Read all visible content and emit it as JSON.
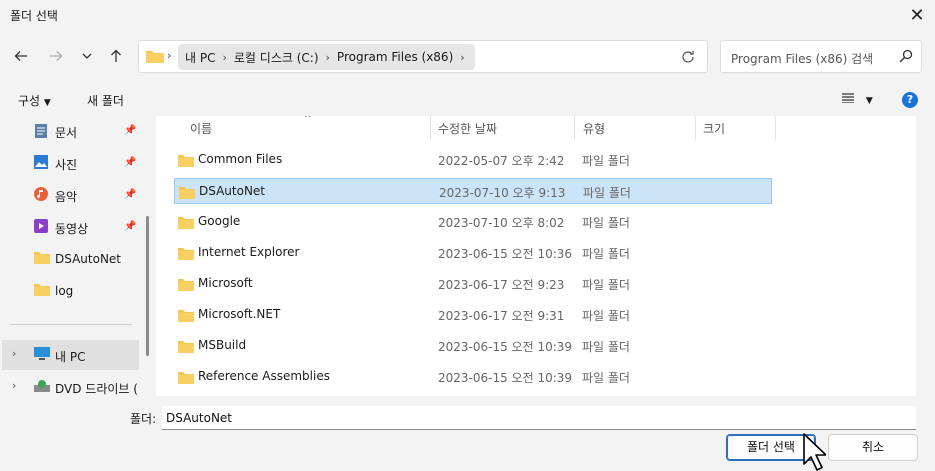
{
  "window": {
    "title": "폴더 선택",
    "close_icon": "close-icon"
  },
  "nav": {
    "back_icon": "arrow-left-icon",
    "forward_icon": "arrow-right-icon",
    "recent_icon": "chevron-down-icon",
    "up_icon": "arrow-up-icon",
    "breadcrumbs": [
      "내 PC",
      "로컬 디스크 (C:)",
      "Program Files (x86)"
    ],
    "refresh_icon": "refresh-icon"
  },
  "search": {
    "placeholder": "Program Files (x86) 검색"
  },
  "toolbar": {
    "organize_label": "구성",
    "new_folder_label": "새 폴더",
    "help": "?"
  },
  "sidebar": {
    "items": [
      {
        "label": "문서",
        "icon": "documents-icon",
        "pinned": true
      },
      {
        "label": "사진",
        "icon": "pictures-icon",
        "pinned": true
      },
      {
        "label": "음악",
        "icon": "music-icon",
        "pinned": true
      },
      {
        "label": "동영상",
        "icon": "videos-icon",
        "pinned": true
      },
      {
        "label": "DSAutoNet",
        "icon": "folder-icon",
        "pinned": false
      },
      {
        "label": "log",
        "icon": "folder-icon",
        "pinned": false
      }
    ],
    "tree": [
      {
        "label": "내 PC",
        "icon": "computer-icon"
      },
      {
        "label": "DVD 드라이브 (",
        "icon": "dvd-drive-icon"
      }
    ]
  },
  "list": {
    "columns": [
      "이름",
      "수정한 날짜",
      "유형",
      "크기"
    ],
    "rows": [
      {
        "name": "Common Files",
        "date": "2022-05-07 오후 2:42",
        "type": "파일 폴더"
      },
      {
        "name": "DSAutoNet",
        "date": "2023-07-10 오후 9:13",
        "type": "파일 폴더",
        "selected": true
      },
      {
        "name": "Google",
        "date": "2023-07-10 오후 8:02",
        "type": "파일 폴더"
      },
      {
        "name": "Internet Explorer",
        "date": "2023-06-15 오전 10:36",
        "type": "파일 폴더"
      },
      {
        "name": "Microsoft",
        "date": "2023-06-17 오전 9:23",
        "type": "파일 폴더"
      },
      {
        "name": "Microsoft.NET",
        "date": "2023-06-17 오전 9:31",
        "type": "파일 폴더"
      },
      {
        "name": "MSBuild",
        "date": "2023-06-15 오전 10:39",
        "type": "파일 폴더"
      },
      {
        "name": "Reference Assemblies",
        "date": "2023-06-15 오전 10:39",
        "type": "파일 폴더"
      }
    ]
  },
  "footer": {
    "folder_label": "폴더:",
    "folder_value": "DSAutoNet",
    "select_label": "폴더 선택",
    "cancel_label": "취소"
  },
  "colors": {
    "accent": "#1a73d9",
    "selection": "#cce4f7",
    "folder": "#f5c44a"
  }
}
